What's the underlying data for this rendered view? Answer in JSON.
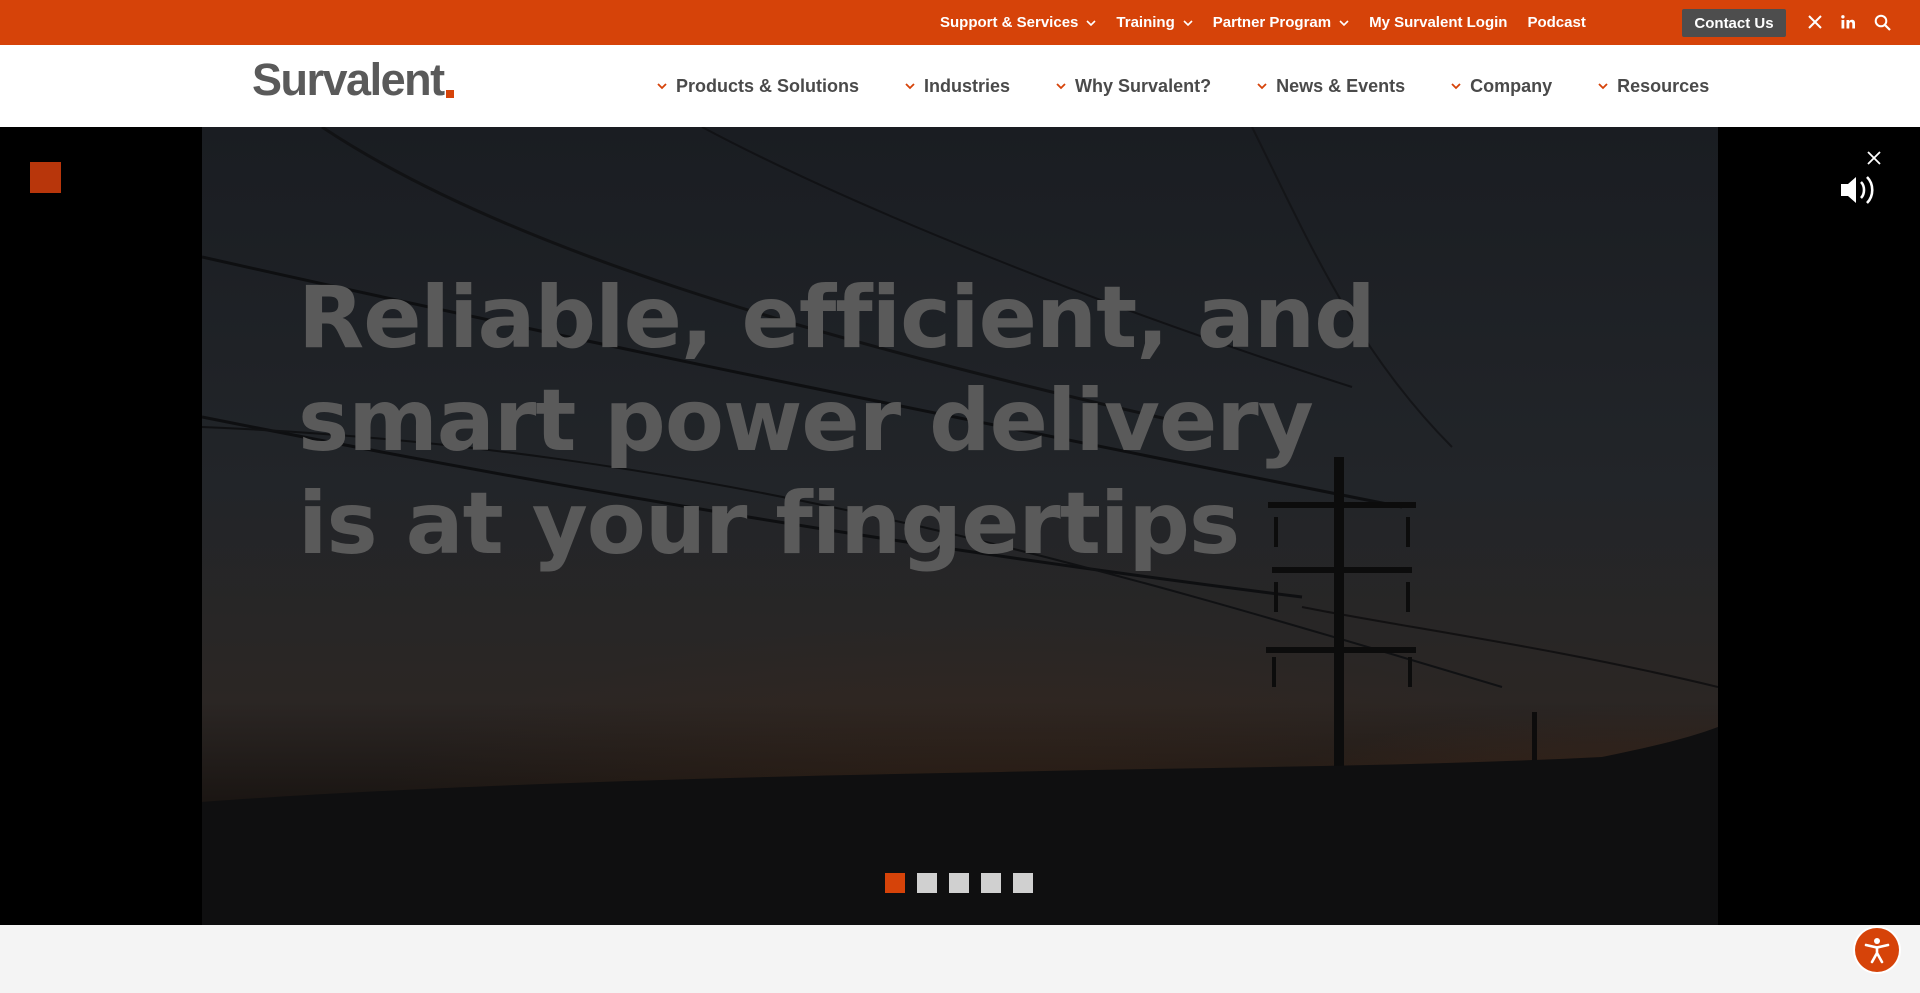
{
  "topbar": {
    "items": [
      {
        "label": "Support & Services",
        "has_menu": true
      },
      {
        "label": "Training",
        "has_menu": true
      },
      {
        "label": "Partner Program",
        "has_menu": true
      },
      {
        "label": "My Survalent Login",
        "has_menu": false
      },
      {
        "label": "Podcast",
        "has_menu": false
      }
    ],
    "contact_label": "Contact Us",
    "icons": [
      "x-twitter-icon",
      "linkedin-icon",
      "search-icon"
    ]
  },
  "header": {
    "logo_text": "Survalent",
    "nav": [
      {
        "label": "Products & Solutions"
      },
      {
        "label": "Industries"
      },
      {
        "label": "Why Survalent?"
      },
      {
        "label": "News & Events"
      },
      {
        "label": "Company"
      },
      {
        "label": "Resources"
      }
    ]
  },
  "hero": {
    "title_lines": [
      "Reliable, efficient, and",
      "smart power delivery",
      "is at your fingertips"
    ],
    "slides_count": 5,
    "active_slide": 1
  },
  "colors": {
    "brand_orange": "#d64309",
    "header_text": "#4a4a4a",
    "button_dark": "#4d4d4d"
  }
}
